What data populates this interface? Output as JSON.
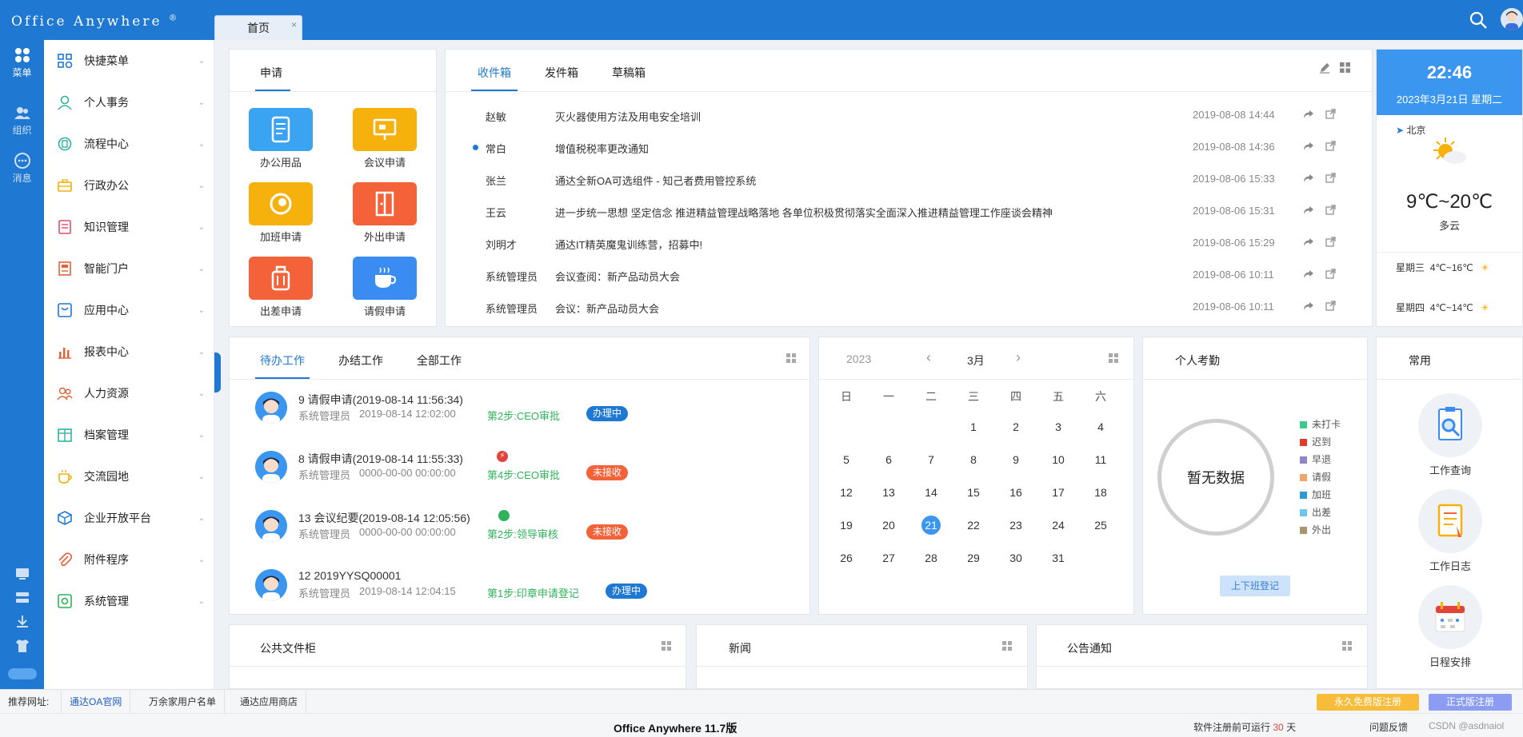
{
  "app": {
    "logo": "Office Anywhere",
    "logo_mark": "®",
    "tab_home": "首页",
    "tab_close": "×"
  },
  "rail": [
    {
      "label": "菜单",
      "icon": "grid-icon"
    },
    {
      "label": "组织",
      "icon": "people-icon"
    },
    {
      "label": "消息",
      "icon": "chat-icon"
    }
  ],
  "menu": [
    {
      "label": "快捷菜单",
      "icon": "quick-menu-icon",
      "color": "#1f78d1"
    },
    {
      "label": "个人事务",
      "icon": "user-icon",
      "color": "#2fb3a0"
    },
    {
      "label": "流程中心",
      "icon": "flow-icon",
      "color": "#2fb3a0"
    },
    {
      "label": "行政办公",
      "icon": "briefcase-icon",
      "color": "#f2b10c"
    },
    {
      "label": "知识管理",
      "icon": "book-icon",
      "color": "#e24b6a"
    },
    {
      "label": "智能门户",
      "icon": "portal-icon",
      "color": "#e2643a"
    },
    {
      "label": "应用中心",
      "icon": "app-icon",
      "color": "#1f78d1"
    },
    {
      "label": "报表中心",
      "icon": "chart-icon",
      "color": "#e2643a"
    },
    {
      "label": "人力资源",
      "icon": "hr-icon",
      "color": "#e2643a"
    },
    {
      "label": "档案管理",
      "icon": "archive-icon",
      "color": "#2fb3a0"
    },
    {
      "label": "交流园地",
      "icon": "cup-icon",
      "color": "#f2b10c"
    },
    {
      "label": "企业开放平台",
      "icon": "cube-icon",
      "color": "#1f78d1"
    },
    {
      "label": "附件程序",
      "icon": "paperclip-icon",
      "color": "#e2643a"
    },
    {
      "label": "系统管理",
      "icon": "settings-icon",
      "color": "#2fb35a"
    }
  ],
  "apply": {
    "tab": "申请",
    "items": [
      {
        "label": "办公用品",
        "color": "#3aa3f2",
        "icon": "notebook-icon"
      },
      {
        "label": "会议申请",
        "color": "#f7b10c",
        "icon": "presentation-icon"
      },
      {
        "label": "加班申请",
        "color": "#f7b10c",
        "icon": "clock-icon"
      },
      {
        "label": "外出申请",
        "color": "#f4623a",
        "icon": "door-icon"
      },
      {
        "label": "出差申请",
        "color": "#f4623a",
        "icon": "luggage-icon"
      },
      {
        "label": "请假申请",
        "color": "#3a8cf2",
        "icon": "coffee-icon"
      }
    ]
  },
  "mail": {
    "tabs": [
      "收件箱",
      "发件箱",
      "草稿箱"
    ],
    "rows": [
      {
        "from": "赵敏",
        "subject": "灭火器使用方法及用电安全培训",
        "time": "2019-08-08 14:44",
        "unread": false
      },
      {
        "from": "常白",
        "subject": "增值税税率更改通知",
        "time": "2019-08-08 14:36",
        "unread": true
      },
      {
        "from": "张兰",
        "subject": "通达全新OA可选组件 - 知己者费用管控系统",
        "time": "2019-08-06 15:33",
        "unread": false
      },
      {
        "from": "王云",
        "subject": "进一步统一思想 坚定信念 推进精益管理战略落地 各单位积极贯彻落实全面深入推进精益管理工作座谈会精神",
        "time": "2019-08-06 15:31",
        "unread": false
      },
      {
        "from": "刘明才",
        "subject": "通达IT精英魔鬼训练营，招募中!",
        "time": "2019-08-06 15:29",
        "unread": false
      },
      {
        "from": "系统管理员",
        "subject": "会议查阅：新产品动员大会",
        "time": "2019-08-06 10:11",
        "unread": false
      },
      {
        "from": "系统管理员",
        "subject": "会议：新产品动员大会",
        "time": "2019-08-06 10:11",
        "unread": false
      }
    ]
  },
  "weather": {
    "clock": "22:46",
    "date": "2023年3月21日 星期二",
    "city": "北京",
    "temp": "9℃~20℃",
    "desc": "多云",
    "forecast": [
      {
        "day": "星期三",
        "temp": "4℃~16℃"
      },
      {
        "day": "星期四",
        "temp": "4℃~14℃"
      }
    ]
  },
  "todo": {
    "tabs": [
      "待办工作",
      "办结工作",
      "全部工作"
    ],
    "items": [
      {
        "title": "9   请假申请(2019-08-14 11:56:34)",
        "user": "系统管理员",
        "time": "2019-08-14 12:02:00",
        "step": "第2步:CEO审批",
        "badge": "办理中",
        "badge_type": "blue",
        "flag": ""
      },
      {
        "title": "8   请假申请(2019-08-14 11:55:33)",
        "user": "系统管理员",
        "time": "0000-00-00 00:00:00",
        "step": "第4步:CEO审批",
        "badge": "未接收",
        "badge_type": "red",
        "flag": "urgent-icon"
      },
      {
        "title": "13   会议纪要(2019-08-14 12:05:56)",
        "user": "系统管理员",
        "time": "0000-00-00 00:00:00",
        "step": "第2步:领导审核",
        "badge": "未接收",
        "badge_type": "red",
        "flag": "normal-icon"
      },
      {
        "title": "12   2019YYSQ00001",
        "user": "系统管理员",
        "time": "2019-08-14 12:04:15",
        "step": "第1步:印章申请登记",
        "badge": "办理中",
        "badge_type": "blue",
        "flag": ""
      }
    ]
  },
  "calendar": {
    "year": "2023",
    "month": "3月",
    "weekdays": [
      "日",
      "一",
      "二",
      "三",
      "四",
      "五",
      "六"
    ],
    "first_weekday": 3,
    "days": 31,
    "today": 21
  },
  "attendance": {
    "title": "个人考勤",
    "empty": "暂无数据",
    "button": "上下班登记",
    "legend": [
      {
        "label": "未打卡",
        "color": "#3cc98a"
      },
      {
        "label": "迟到",
        "color": "#e03b2b"
      },
      {
        "label": "早退",
        "color": "#8b86c9"
      },
      {
        "label": "请假",
        "color": "#f4a36b"
      },
      {
        "label": "加班",
        "color": "#2a9bd6"
      },
      {
        "label": "出差",
        "color": "#6ec6ee"
      },
      {
        "label": "外出",
        "color": "#a8946e"
      }
    ]
  },
  "common": {
    "title": "常用",
    "items": [
      {
        "label": "工作查询",
        "icon": "search-doc-icon"
      },
      {
        "label": "工作日志",
        "icon": "log-icon"
      },
      {
        "label": "日程安排",
        "icon": "calendar-icon"
      }
    ]
  },
  "bottom_panels": [
    "公共文件柜",
    "新闻",
    "公告通知"
  ],
  "footer": {
    "links": [
      "推荐网址:",
      "通达OA官网",
      "万余家用户名单",
      "通达应用商店"
    ],
    "btn_free": "永久免费版注册",
    "btn_official": "正式版注册",
    "version": "Office Anywhere 11.7版",
    "trial_prefix": "软件注册前可运行",
    "trial_days": "30",
    "trial_suffix": "天",
    "feedback": "问题反馈",
    "watermark": "CSDN @asdnaiol"
  }
}
